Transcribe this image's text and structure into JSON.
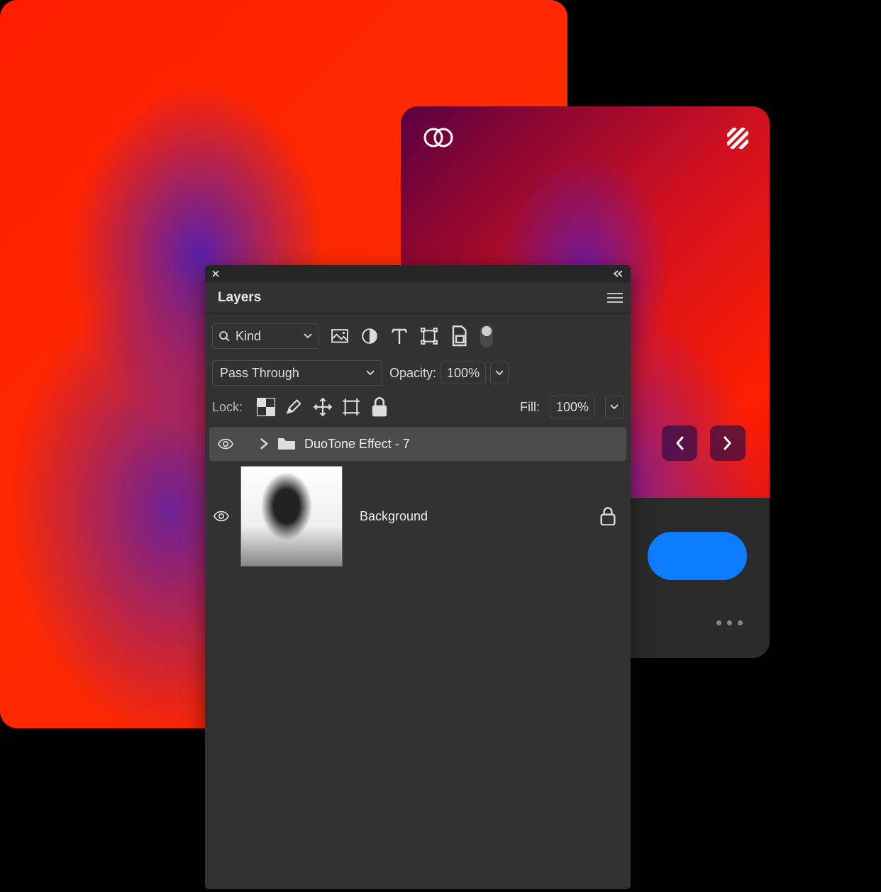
{
  "panel": {
    "tab_label": "Layers",
    "filter": {
      "kind_label": "Kind",
      "icons": [
        "image",
        "adjustment",
        "type",
        "shape",
        "smartobject"
      ]
    },
    "blend": {
      "mode": "Pass Through",
      "opacity_label": "Opacity:",
      "opacity_value": "100%"
    },
    "lock": {
      "label": "Lock:",
      "icons": [
        "transparency",
        "pixels",
        "position",
        "artboard",
        "all"
      ],
      "fill_label": "Fill:",
      "fill_value": "100%"
    },
    "layers": [
      {
        "type": "group",
        "name": "DuoTone Effect - 7",
        "visible": true,
        "selected": true,
        "collapsed": true
      },
      {
        "type": "image",
        "name": "Background",
        "visible": true,
        "locked": true
      }
    ]
  },
  "right_card": {
    "top_icons": [
      "overlap-circles",
      "hatch"
    ],
    "nav": [
      "prev",
      "next"
    ]
  }
}
